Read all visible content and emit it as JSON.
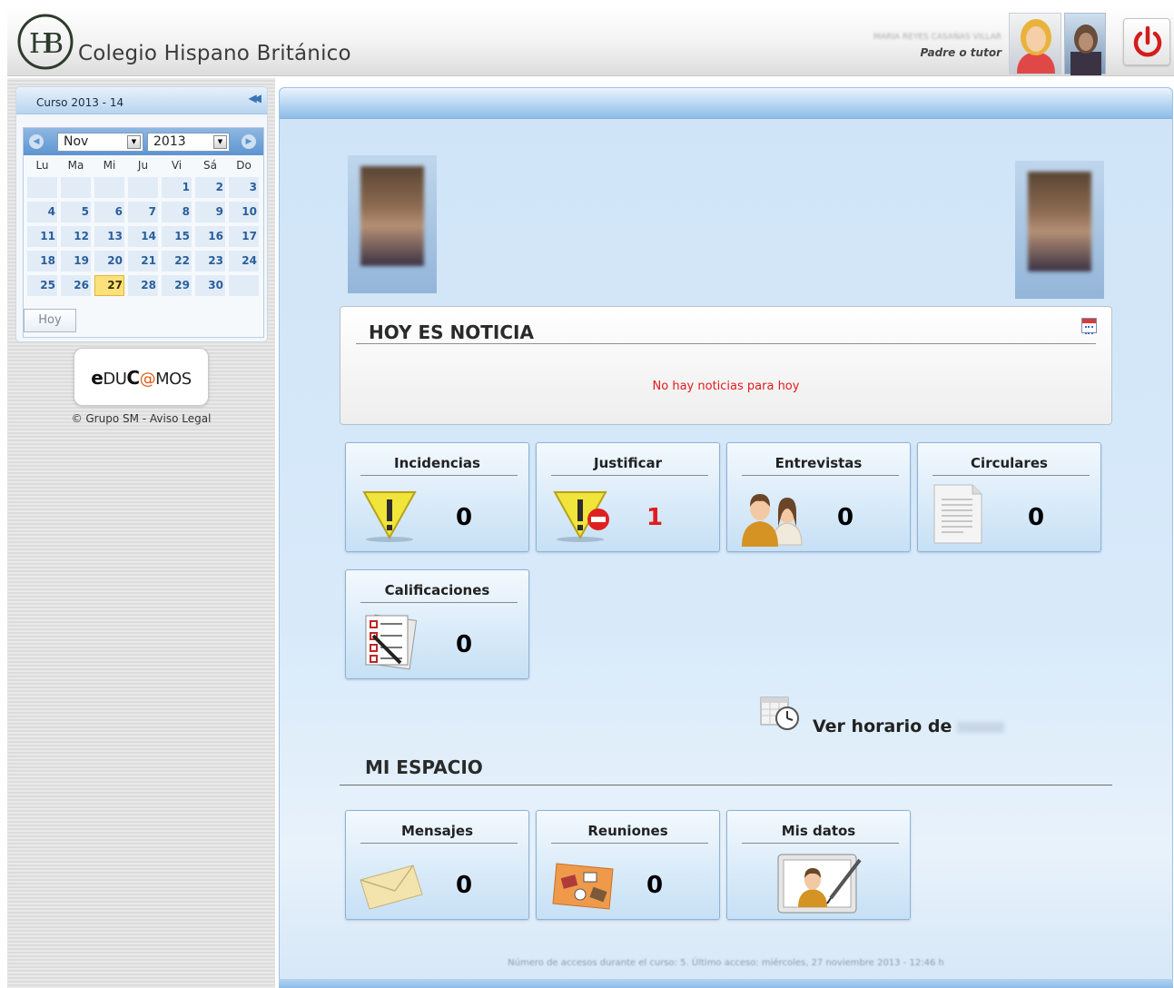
{
  "header": {
    "school_name": "Colegio Hispano Británico",
    "user_name": "MARIA REYES CASAÑAS VILLAR",
    "user_role": "Padre o tutor",
    "logout_icon": "power-icon"
  },
  "sidebar": {
    "course_label": "Curso 2013 - 14",
    "collapse_icon": "double-chevron-left-icon",
    "calendar": {
      "month": "Nov",
      "year": "2013",
      "weekdays": [
        "Lu",
        "Ma",
        "Mi",
        "Ju",
        "Vi",
        "Sá",
        "Do"
      ],
      "weeks": [
        [
          "",
          "",
          "",
          "",
          "1",
          "2",
          "3"
        ],
        [
          "4",
          "5",
          "6",
          "7",
          "8",
          "9",
          "10"
        ],
        [
          "11",
          "12",
          "13",
          "14",
          "15",
          "16",
          "17"
        ],
        [
          "18",
          "19",
          "20",
          "21",
          "22",
          "23",
          "24"
        ],
        [
          "25",
          "26",
          "27",
          "28",
          "29",
          "30",
          ""
        ]
      ],
      "today": "27",
      "today_button": "Hoy"
    },
    "brand": {
      "e": "e",
      "text_a": "DU",
      "text_b": "C",
      "text_c": "@",
      "text_d": "MOS"
    },
    "legal": "© Grupo SM - Aviso Legal"
  },
  "news": {
    "title": "HOY ES NOTICIA",
    "empty_message": "No hay noticias para hoy"
  },
  "tiles": [
    {
      "label": "Incidencias",
      "count": "0",
      "icon": "warning-icon"
    },
    {
      "label": "Justificar",
      "count": "1",
      "icon": "warning-blocked-icon"
    },
    {
      "label": "Entrevistas",
      "count": "0",
      "icon": "people-icon"
    },
    {
      "label": "Circulares",
      "count": "0",
      "icon": "document-icon"
    },
    {
      "label": "Calificaciones",
      "count": "0",
      "icon": "grades-checklist-icon"
    }
  ],
  "schedule": {
    "label": "Ver horario de",
    "student": "ELSA"
  },
  "my_space": {
    "title": "MI ESPACIO",
    "tiles": [
      {
        "label": "Mensajes",
        "count": "0",
        "icon": "envelope-icon"
      },
      {
        "label": "Reuniones",
        "count": "0",
        "icon": "meeting-icon"
      },
      {
        "label": "Mis datos",
        "icon": "profile-edit-icon"
      }
    ]
  },
  "footer": {
    "text": "Número de accesos durante el curso: 5. Último acceso: miércoles, 27 noviembre 2013 - 12:46 h"
  },
  "colors": {
    "accent": "#8dbce8",
    "alert": "#e01d1d",
    "today": "#fbe17b"
  }
}
